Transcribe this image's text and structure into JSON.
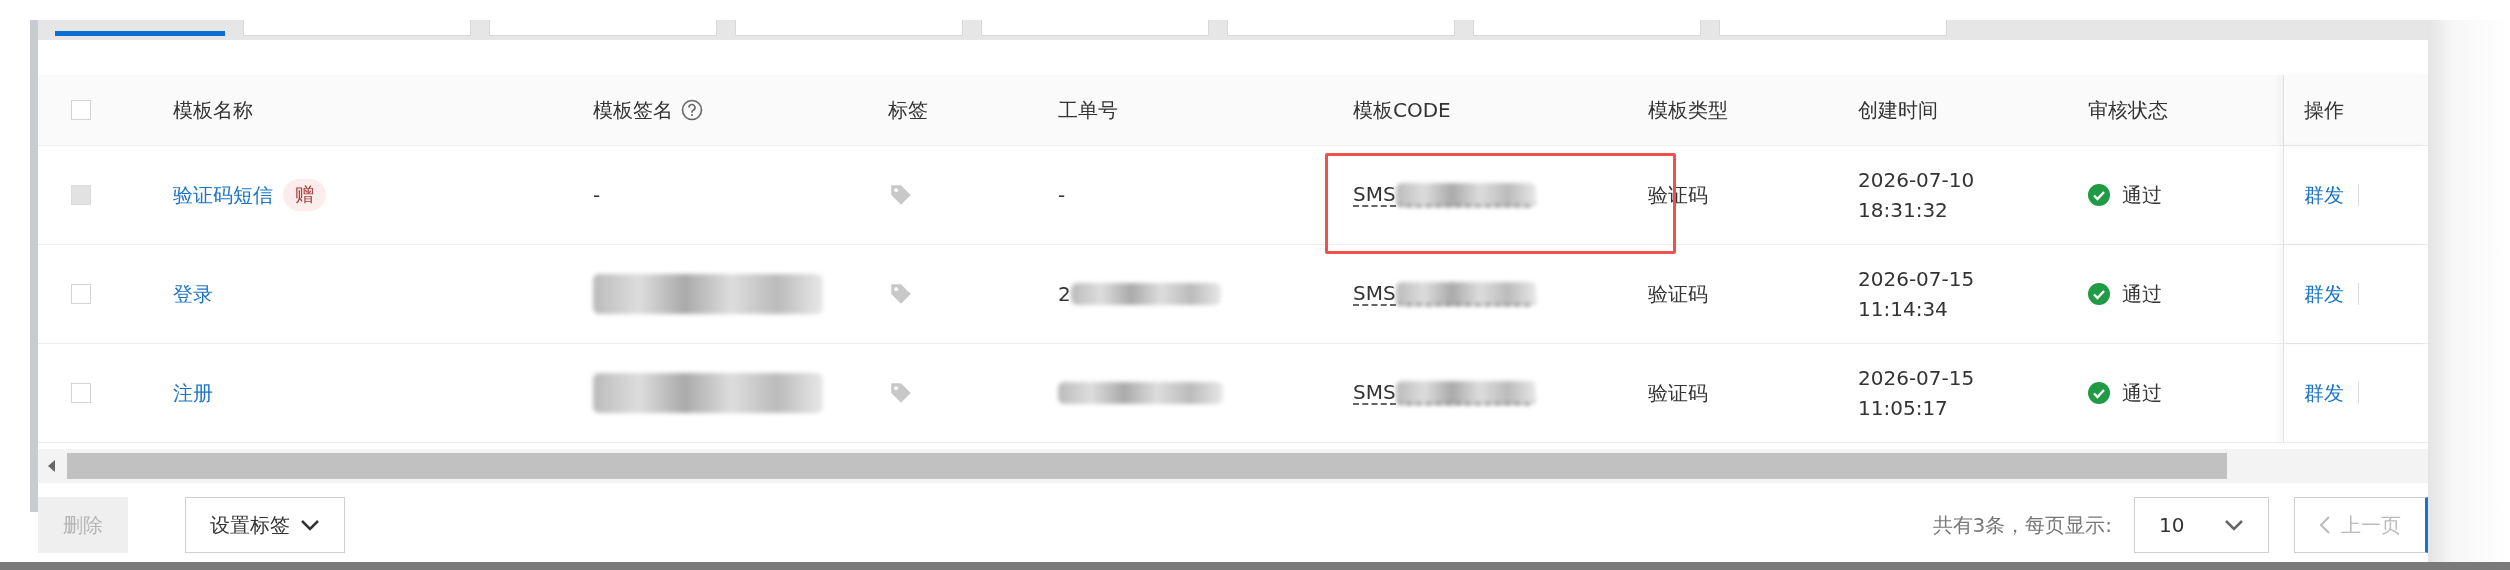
{
  "tabs": [
    {
      "selected": true
    },
    {
      "selected": false
    },
    {
      "selected": false
    },
    {
      "selected": false
    },
    {
      "selected": false
    },
    {
      "selected": false
    },
    {
      "selected": false
    },
    {
      "selected": false
    }
  ],
  "table": {
    "select_all_checked": false,
    "columns": [
      "模板名称",
      "模板签名",
      "标签",
      "工单号",
      "模板CODE",
      "模板类型",
      "创建时间",
      "审核状态",
      "操作"
    ],
    "rows": [
      {
        "checkbox_disabled": true,
        "name": "验证码短信",
        "badge": "赠",
        "signature": "-",
        "signature_blurred": false,
        "work_order": "-",
        "work_order_blurred": false,
        "code": "SMS",
        "type": "验证码",
        "created": "2026-07-10 18:31:32",
        "status": "通过",
        "action": "群发",
        "highlighted": true
      },
      {
        "checkbox_disabled": false,
        "name": "登录",
        "signature_blurred": true,
        "work_order": "2",
        "work_order_blurred": true,
        "code": "SMS",
        "type": "验证码",
        "created": "2026-07-15 11:14:34",
        "status": "通过",
        "action": "群发",
        "highlighted": false
      },
      {
        "checkbox_disabled": false,
        "name": "注册",
        "signature_blurred": true,
        "work_order_blurred": true,
        "code": "SMS",
        "type": "验证码",
        "created": "2026-07-15 11:05:17",
        "status": "通过",
        "action": "群发",
        "highlighted": false
      }
    ]
  },
  "footer": {
    "delete_button": {
      "label": "删除",
      "disabled": true
    },
    "tag_button": "设置标签",
    "total": "共有3条，每页显示:",
    "page_size": "10",
    "prev_button": "上一页"
  }
}
